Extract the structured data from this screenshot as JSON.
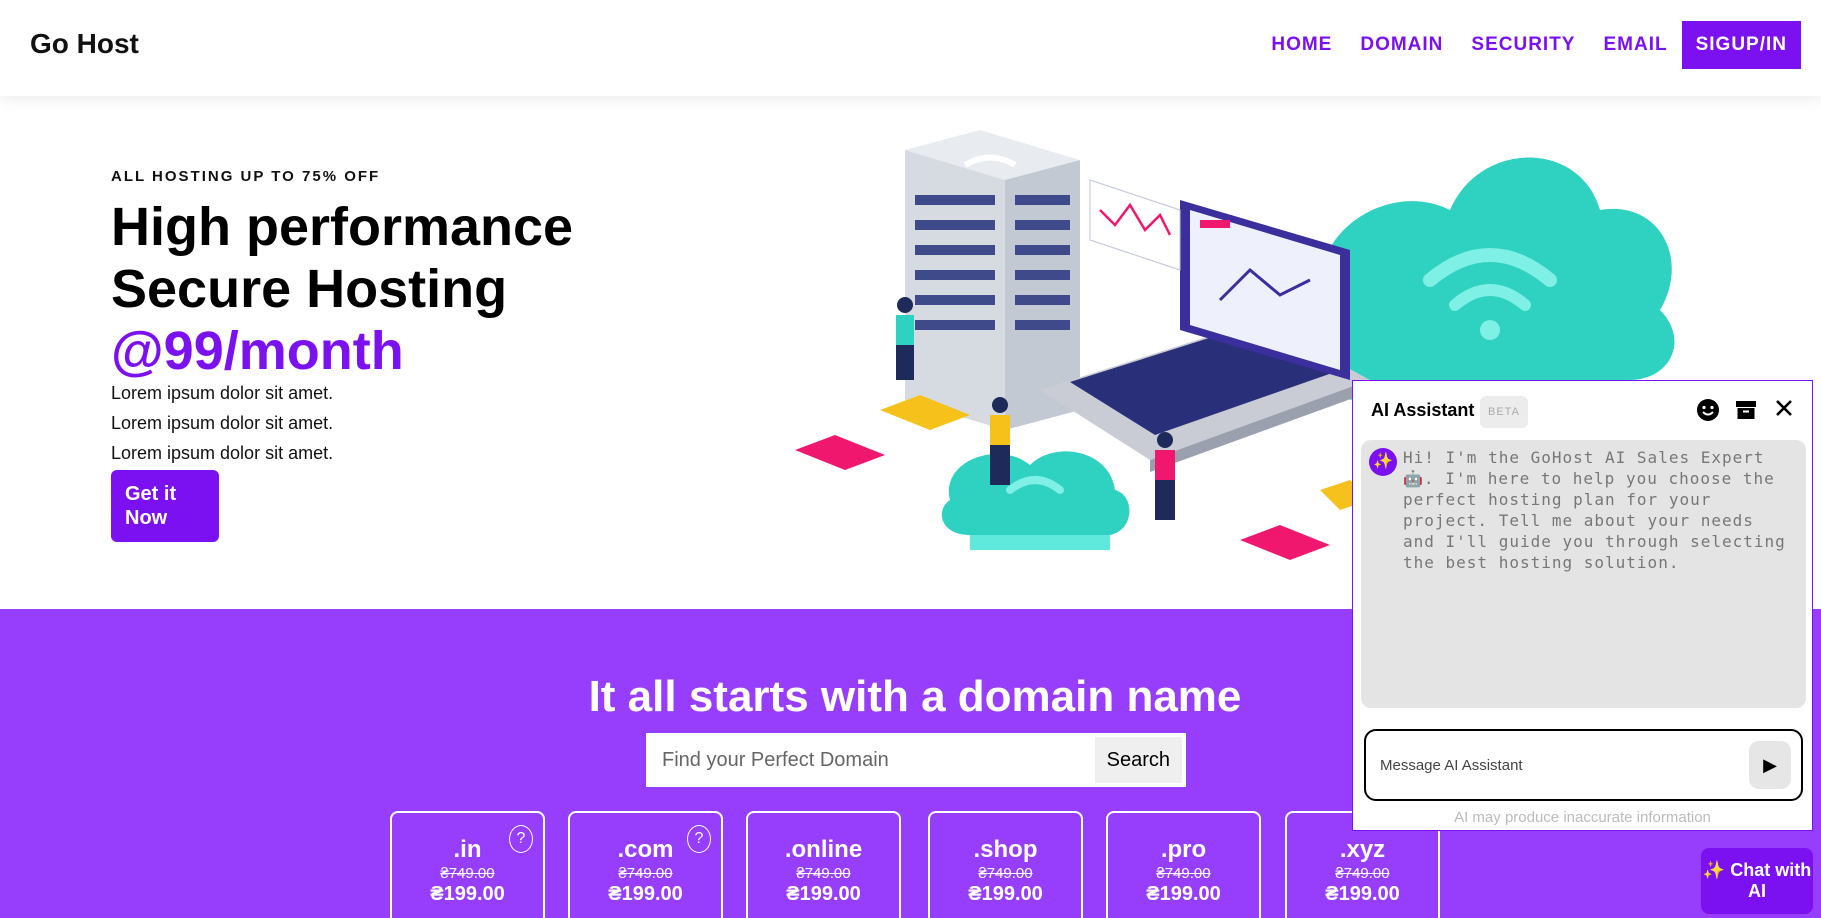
{
  "brand": "Go Host",
  "nav": {
    "items": [
      "HOME",
      "DOMAIN",
      "SECURITY",
      "EMAIL"
    ],
    "cta": "SIGUP/IN"
  },
  "hero": {
    "eyebrow": "ALL HOSTING UP TO 75% OFF",
    "title_line1": "High performance",
    "title_line2": "Secure Hosting",
    "price": "@99/month",
    "lines": [
      "Lorem ipsum dolor sit amet.",
      "Lorem ipsum dolor sit amet.",
      "Lorem ipsum dolor sit amet."
    ],
    "button": "Get it Now"
  },
  "domain": {
    "title": "It all starts with a domain name",
    "search_placeholder": "Find your Perfect Domain",
    "search_button": "Search",
    "tlds": [
      {
        "name": ".in",
        "old": "₴749.00",
        "new": "₴199.00",
        "help": "?"
      },
      {
        "name": ".com",
        "old": "₴749.00",
        "new": "₴199.00",
        "help": "?"
      },
      {
        "name": ".online",
        "old": "₴749.00",
        "new": "₴199.00"
      },
      {
        "name": ".shop",
        "old": "₴749.00",
        "new": "₴199.00"
      },
      {
        "name": ".pro",
        "old": "₴749.00",
        "new": "₴199.00"
      },
      {
        "name": ".xyz",
        "old": "₴749.00",
        "new": "₴199.00"
      }
    ]
  },
  "assistant": {
    "title": "AI Assistant",
    "badge": "BETA",
    "icons": [
      "smiley-icon",
      "archive-icon",
      "close-icon"
    ],
    "avatar": "✨",
    "message": "Hi! I'm the GoHost AI Sales Expert 🤖. I'm here to help you choose the perfect hosting plan for your project. Tell me about your needs and I'll guide you through selecting the best hosting solution.",
    "input_placeholder": "Message AI Assistant",
    "send": "▶",
    "disclaimer": "AI may produce inaccurate information",
    "fab": "✨ Chat with AI"
  },
  "colors": {
    "accent": "#7b10f0",
    "band": "#973efc",
    "teal": "#2fd1c1",
    "pink": "#f0176e",
    "yellow": "#f6c11b"
  }
}
